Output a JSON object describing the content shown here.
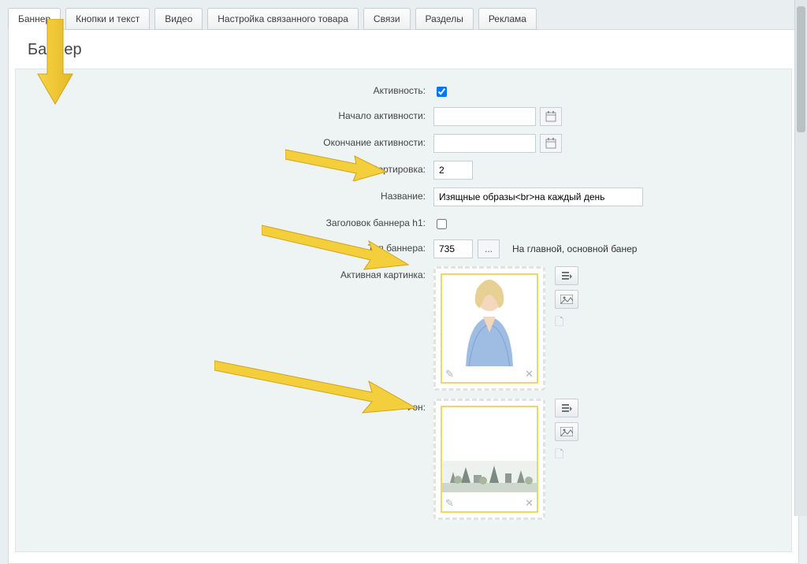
{
  "tabs": [
    "Баннер",
    "Кнопки и текст",
    "Видео",
    "Настройка связанного товара",
    "Связи",
    "Разделы",
    "Реклама"
  ],
  "page_title": "Баннер",
  "labels": {
    "activity": "Активность:",
    "start": "Начало активности:",
    "end": "Окончание активности:",
    "sort": "Сортировка:",
    "name": "Название:",
    "h1": "Заголовок баннера h1:",
    "type": "Тип баннера:",
    "active_pic": "Активная картинка:",
    "fon": "Фон:"
  },
  "values": {
    "sort": "2",
    "name": "Изящные образы<br>на каждый день",
    "type_id": "735",
    "type_text": "На главной, основной банер"
  },
  "buttons": {
    "dots": "..."
  }
}
